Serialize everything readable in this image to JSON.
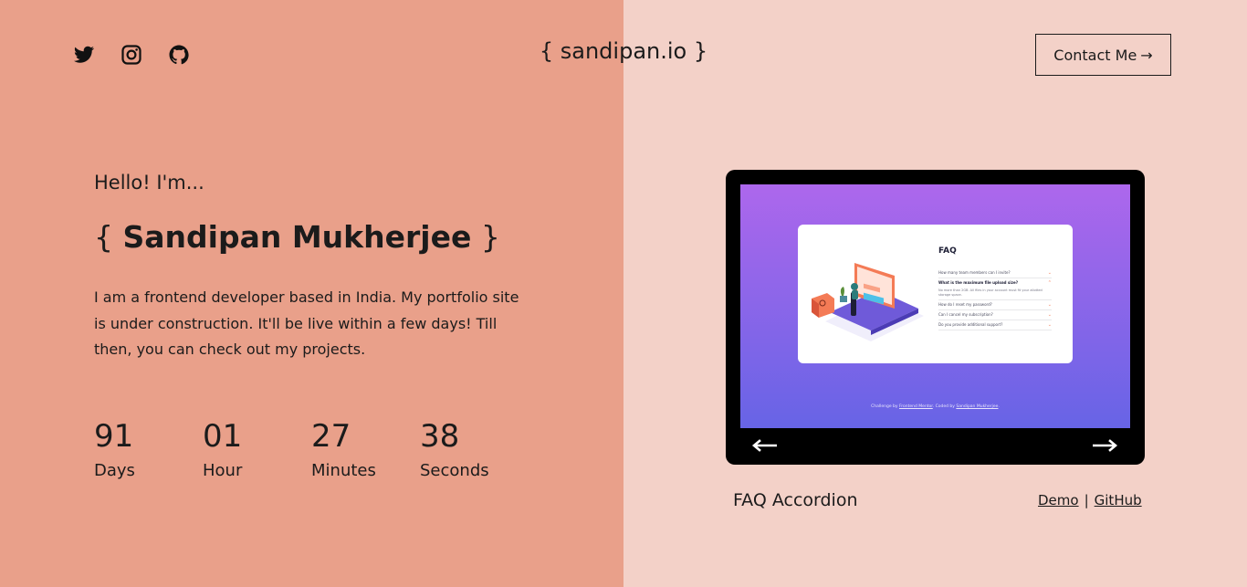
{
  "colors": {
    "left_bg": "#e9a08a",
    "right_bg": "#f3d1c8",
    "text": "#1b1b1b",
    "device_frame": "#000000"
  },
  "header": {
    "social_icons": [
      "twitter-icon",
      "instagram-icon",
      "github-icon"
    ],
    "logo": "{ sandipan.io }",
    "contact_label": "Contact Me",
    "contact_arrow": "→"
  },
  "intro": {
    "greeting": "Hello! I'm...",
    "name_open": "{ ",
    "name": "Sandipan Mukherjee",
    "name_close": " }",
    "bio": "I am a frontend developer based in India. My portfolio site is under construction. It'll be live within a few days! Till then, you can check out my projects."
  },
  "countdown": [
    {
      "value": "91",
      "label": "Days"
    },
    {
      "value": "01",
      "label": "Hour"
    },
    {
      "value": "27",
      "label": "Minutes"
    },
    {
      "value": "38",
      "label": "Seconds"
    }
  ],
  "project": {
    "title": "FAQ Accordion",
    "demo_label": "Demo",
    "separator": "|",
    "github_label": "GitHub",
    "preview": {
      "faq_title": "FAQ",
      "questions": [
        "How many team members can I invite?",
        "What is the maximum file upload size?",
        "How do I reset my password?",
        "Can I cancel my subscription?",
        "Do you provide additional support?"
      ],
      "answer": "No more than 2GB. All files in your account must fit your allotted storage space.",
      "attribution_prefix": "Challenge by ",
      "attribution_fm": "Frontend Mentor",
      "attribution_mid": ". Coded by ",
      "attribution_author": "Sandipan Mukherjee",
      "attribution_end": "."
    },
    "prev_icon": "arrow-left-icon",
    "next_icon": "arrow-right-icon"
  }
}
